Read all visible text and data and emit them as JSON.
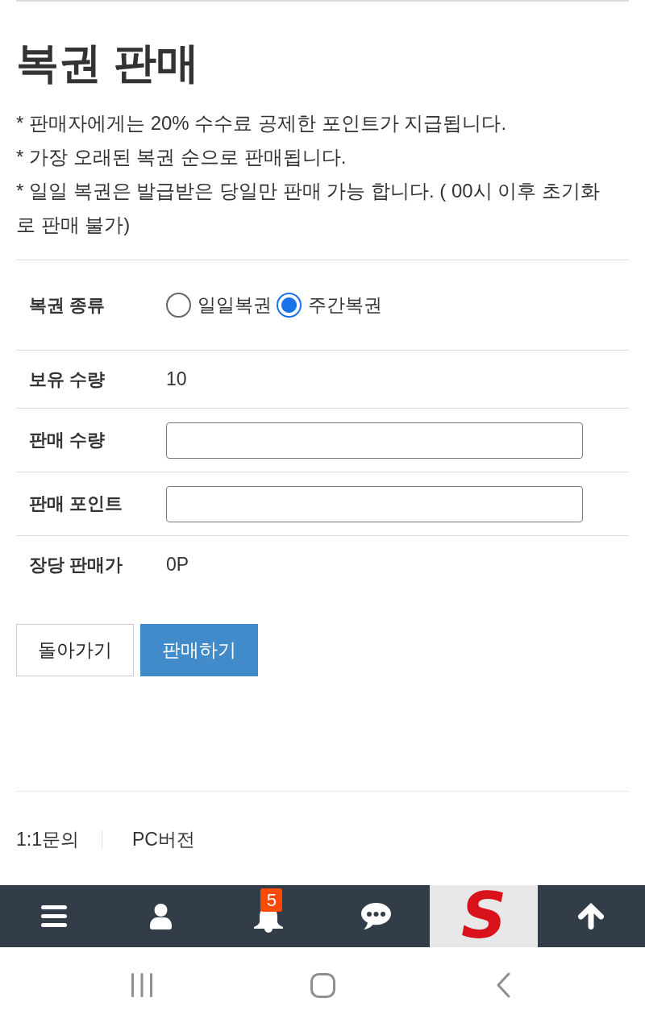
{
  "title": "복권 판매",
  "notes": [
    "* 판매자에게는 20% 수수료 공제한 포인트가 지급됩니다.",
    "* 가장 오래된 복권 순으로 판매됩니다.",
    "* 일일 복권은 발급받은 당일만 판매 가능 합니다. ( 00시 이후 초기화로 판매 불가)"
  ],
  "form": {
    "rows": [
      {
        "kind": "radio",
        "label": "복권 종류",
        "options": [
          {
            "label": "일일복권",
            "selected": false
          },
          {
            "label": "주간복권",
            "selected": true
          }
        ]
      },
      {
        "kind": "text",
        "label": "보유 수량",
        "value": "10"
      },
      {
        "kind": "input",
        "label": "판매 수량"
      },
      {
        "kind": "input",
        "label": "판매 포인트"
      },
      {
        "kind": "text",
        "label": "장당 판매가",
        "value": "0P"
      }
    ]
  },
  "buttons": [
    {
      "kind": "secondary",
      "label": "돌아가기"
    },
    {
      "kind": "primary",
      "label": "판매하기"
    }
  ],
  "footer_links": [
    "1:1문의",
    "PC버전"
  ],
  "bottom_nav": [
    {
      "kind": "menu"
    },
    {
      "kind": "user"
    },
    {
      "kind": "bell",
      "badge": "5"
    },
    {
      "kind": "chat"
    },
    {
      "kind": "logo",
      "text": "S"
    },
    {
      "kind": "top"
    }
  ],
  "system_nav": [
    {
      "kind": "recents"
    },
    {
      "kind": "home"
    },
    {
      "kind": "back"
    }
  ]
}
